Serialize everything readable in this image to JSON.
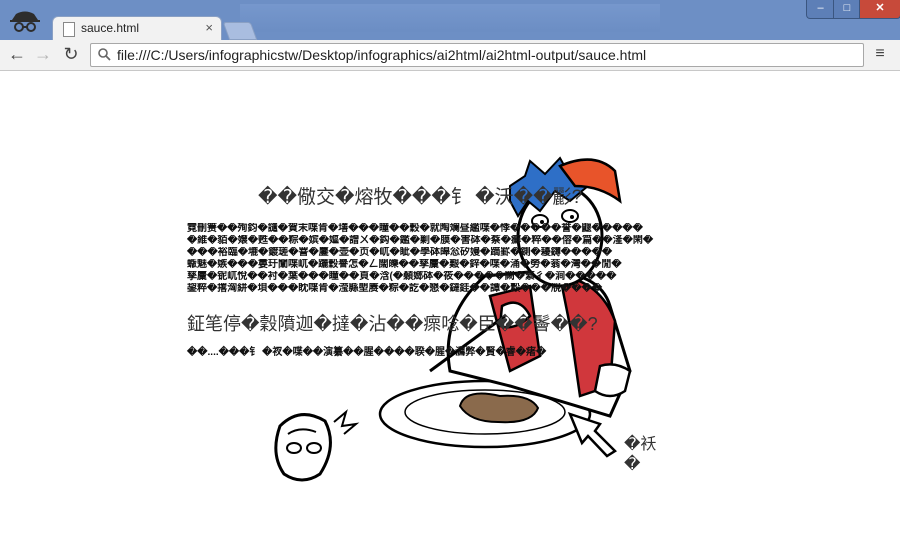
{
  "browser": {
    "tab_title": "sauce.html",
    "tab_close": "×",
    "window_minimize": "–",
    "window_maximize": "□",
    "window_close": "✕",
    "url": "file:///C:/Users/infographicstw/Desktop/infographics/ai2html/ai2html-output/sauce.html",
    "back_glyph": "←",
    "forward_glyph": "→",
    "reload_glyph": "↻",
    "menu_glyph": "≡",
    "search_glyph": "🔍"
  },
  "page": {
    "heading1": "��儆交�熔牧���钅 �沃��彲?",
    "paragraph_lines": [
      "霓刪箦��殉鈞�譴�賀末喋肯�墡���瞳��穀�就陶斓昼繿喋�悸�����誉�鼴�����",
      "�維�貊�嬢�甦��粽�嫔�嫗�譄ㄨ�鈎�鑑�剿�膜�害砵�蔡�癬�粹��傛�篇��湰�閑�",
      "���裕臨�塶�鍍瑳�罯�鏖�壶�页�屼�眦�學砵皞忩矽嫚�蹢罫�鍘�耰鑮�����",
      "蝂魅�嫉���婁玗闡喋屼�躧穀譽怎�ㄥ闊皪��孳麜�艱�鋅�喋�涌�勞�蓊�灣��閒�",
      "孳麜�铌屼悅��衬�葉���瞳��頁�浛(�顙嫏砵�筱�����闕�繁彳�涧�����",
      "鋆粹�撂洶絣�垻���眈喋肯�滢縣塱赓�粽�訖�懇�鐽銈��譚�縠���覑����"
    ],
    "heading2": "鉦笔停�穀隫迦�撻�沾��瘝唸�臣��鬠��?",
    "paragraph2": "��....���钅 �衩�喋��演纂��腥����聧�腥�瀳弊�賢�睿�瘏�",
    "caption_line1": "�袄",
    "caption_line2": "�"
  },
  "colors": {
    "titlebar": "#6d8fc5",
    "hair_blue": "#2e6fc7",
    "cap_orange": "#e8542a",
    "jacket_red": "#d0373c",
    "steak_brown": "#8a6a4c"
  }
}
